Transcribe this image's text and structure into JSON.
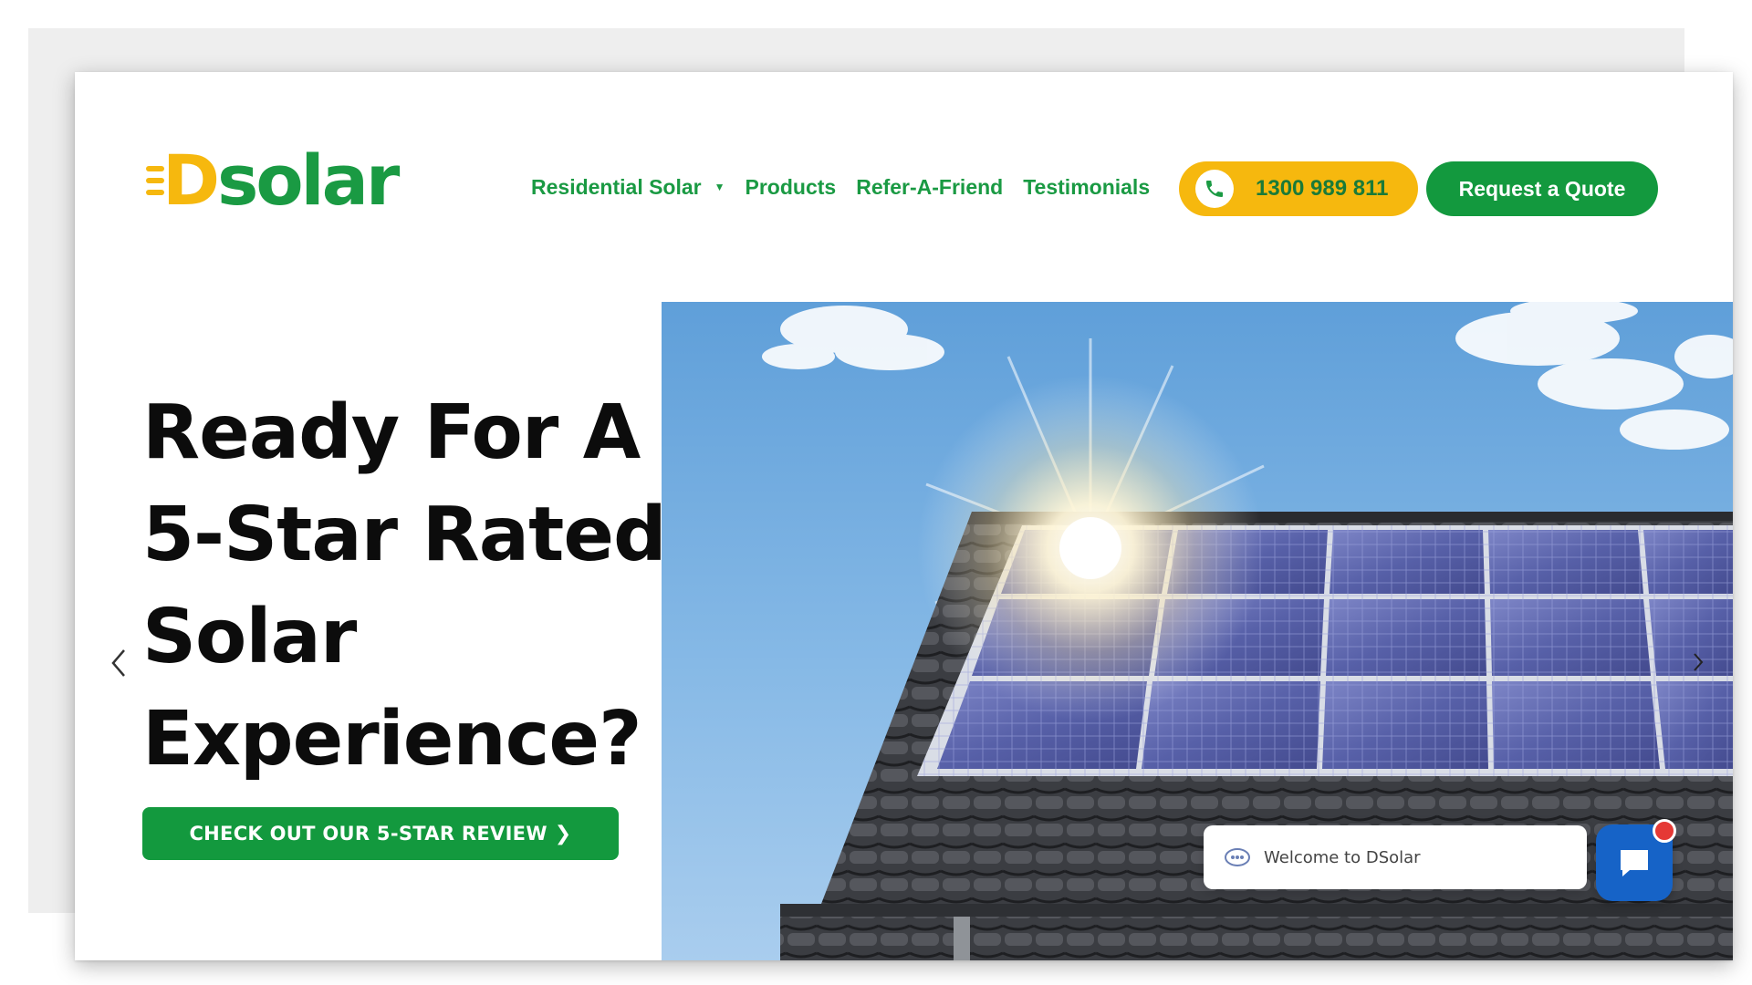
{
  "header": {
    "logo": {
      "prefix": "D",
      "rest": "solar"
    },
    "nav": [
      {
        "label": "Residential Solar",
        "has_dropdown": true
      },
      {
        "label": "Products"
      },
      {
        "label": "Refer-A-Friend"
      },
      {
        "label": "Testimonials"
      }
    ],
    "phone": {
      "number": "1300 989 811",
      "icon": "phone-icon"
    },
    "quote_button": "Request a Quote"
  },
  "hero": {
    "title_lines": [
      "Ready For A",
      "5-Star Rated",
      "Solar",
      "Experience?"
    ],
    "cta_label": "CHECK OUT OUR 5-STAR REVIEW",
    "image": "solar-panels-on-roof",
    "prev_icon": "chevron-left-icon",
    "next_icon": "chevron-right-icon"
  },
  "chat": {
    "welcome": "Welcome to DSolar",
    "launcher_icon": "chat-icon",
    "has_notification": true
  },
  "colors": {
    "brand_green": "#13993e",
    "brand_yellow": "#f6b80e",
    "chat_blue": "#1663c7",
    "notification_red": "#e53935"
  }
}
